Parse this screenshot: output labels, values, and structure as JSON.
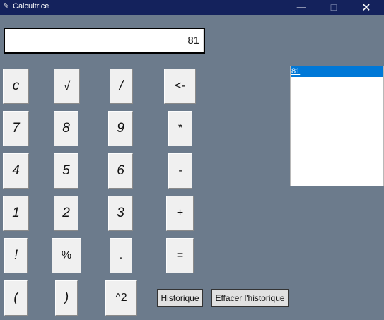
{
  "window": {
    "title": "Calcultrice",
    "icon": "feather-icon",
    "minimize_glyph": "—",
    "maximize_glyph": "☐",
    "close_glyph": "✕"
  },
  "display": {
    "value": "81"
  },
  "keys": {
    "clear": "c",
    "sqrt": "√",
    "divide": "/",
    "backspace": "<-",
    "seven": "7",
    "eight": "8",
    "nine": "9",
    "multiply": "*",
    "four": "4",
    "five": "5",
    "six": "6",
    "minus": "-",
    "one": "1",
    "two": "2",
    "three": "3",
    "plus": "+",
    "factorial": "!",
    "percent": "%",
    "decimal": ".",
    "equals": "=",
    "lparen": "(",
    "rparen": ")",
    "power": "^2"
  },
  "history": {
    "items": [
      "81"
    ],
    "selected_index": 0,
    "show_button": "Historique",
    "clear_button": "Effacer l'historique"
  },
  "colors": {
    "titlebar": "#14225c",
    "background": "#6c7b8c",
    "selection": "#0078d7"
  }
}
